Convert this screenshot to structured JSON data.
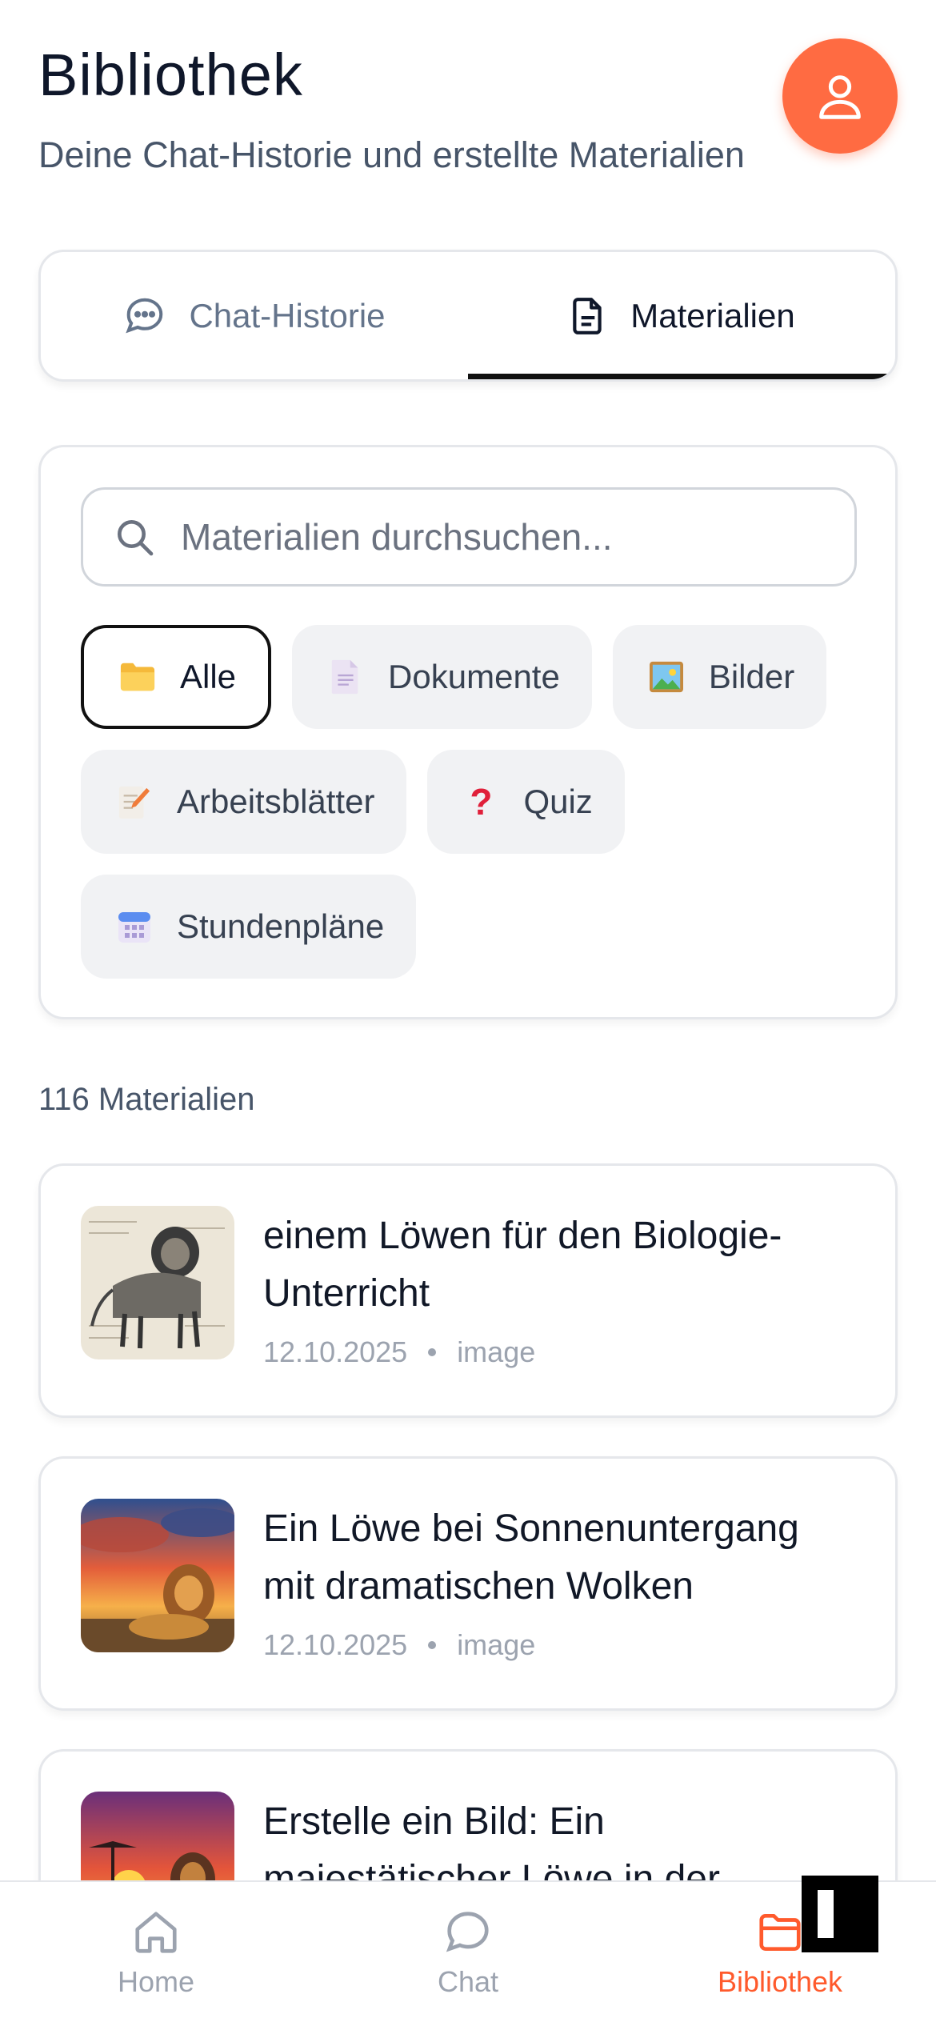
{
  "header": {
    "title": "Bibliothek",
    "subtitle": "Deine Chat-Historie und erstellte Materialien"
  },
  "tabs": [
    {
      "label": "Chat-Historie",
      "icon": "chat-bubble-icon",
      "active": false
    },
    {
      "label": "Materialien",
      "icon": "document-icon",
      "active": true
    }
  ],
  "search": {
    "placeholder": "Materialien durchsuchen..."
  },
  "filters": [
    {
      "label": "Alle",
      "icon": "folder-icon",
      "selected": true
    },
    {
      "label": "Dokumente",
      "icon": "page-icon",
      "selected": false
    },
    {
      "label": "Bilder",
      "icon": "picture-icon",
      "selected": false
    },
    {
      "label": "Arbeitsblätter",
      "icon": "memo-icon",
      "selected": false
    },
    {
      "label": "Quiz",
      "icon": "question-mark-icon",
      "selected": false
    },
    {
      "label": "Stundenpläne",
      "icon": "calendar-icon",
      "selected": false
    }
  ],
  "count_label": "116 Materialien",
  "materials": [
    {
      "title": "einem Löwen für den Biologie-Unterricht",
      "date": "12.10.2025",
      "type": "image"
    },
    {
      "title": "Ein Löwe bei Sonnenuntergang mit dramatischen Wolken",
      "date": "12.10.2025",
      "type": "image"
    },
    {
      "title": "Erstelle ein Bild: Ein majestätischer Löwe in der",
      "date": "",
      "type": ""
    }
  ],
  "bottom_nav": [
    {
      "label": "Home",
      "icon": "home-icon",
      "active": false
    },
    {
      "label": "Chat",
      "icon": "chat-icon",
      "active": false
    },
    {
      "label": "Bibliothek",
      "icon": "folder-icon",
      "active": true
    }
  ],
  "colors": {
    "accent": "#ff6b42",
    "active_nav": "#ff5a2c"
  }
}
